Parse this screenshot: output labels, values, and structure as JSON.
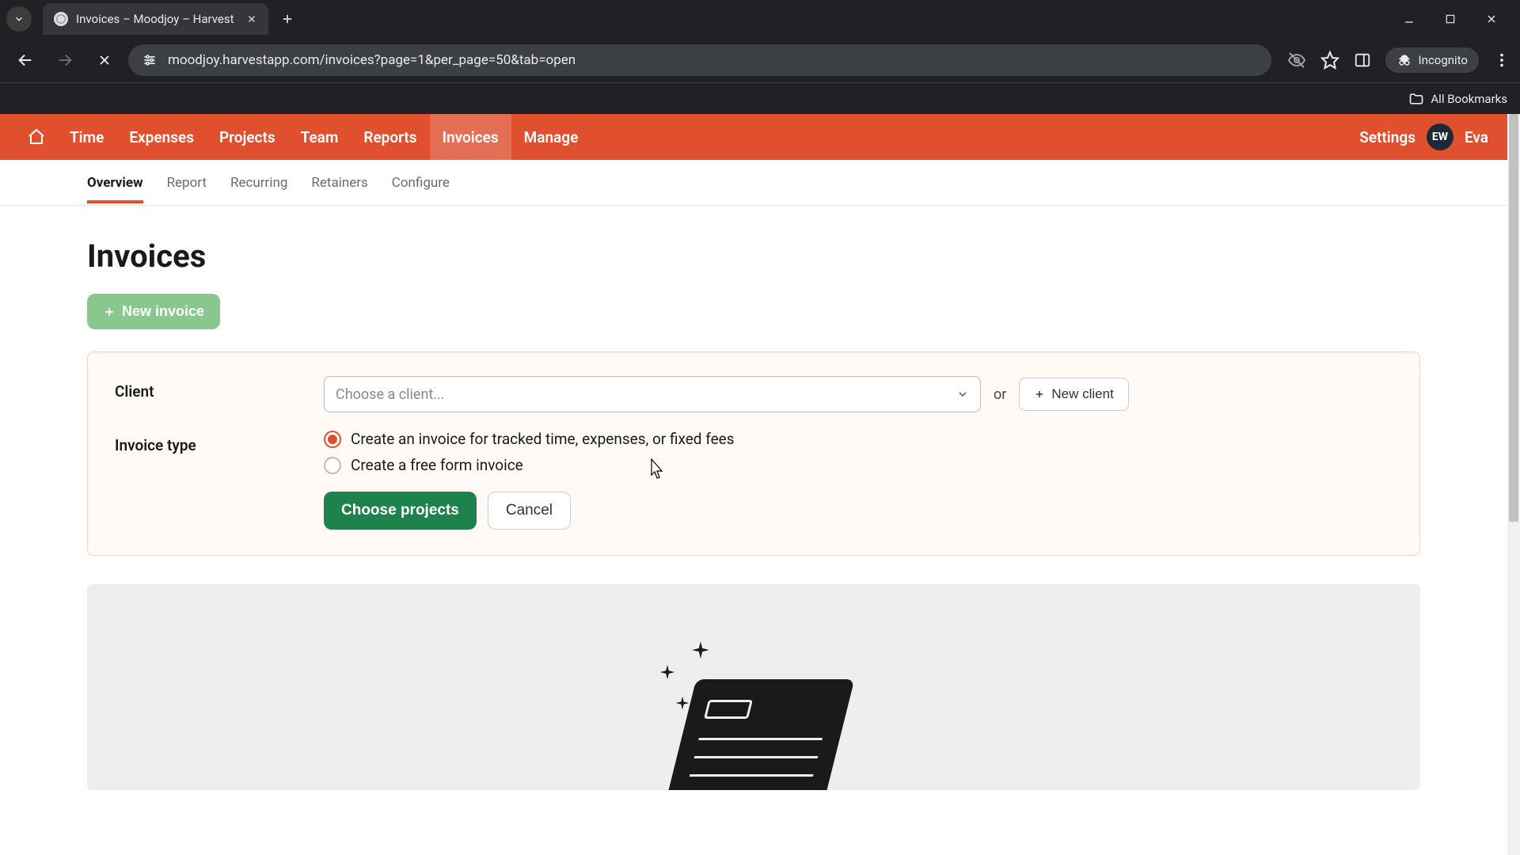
{
  "browser": {
    "tab_title": "Invoices – Moodjoy – Harvest",
    "url": "moodjoy.harvestapp.com/invoices?page=1&per_page=50&tab=open",
    "incognito_label": "Incognito",
    "all_bookmarks_label": "All Bookmarks"
  },
  "topnav": {
    "items": [
      "Time",
      "Expenses",
      "Projects",
      "Team",
      "Reports",
      "Invoices",
      "Manage"
    ],
    "active": "Invoices",
    "settings_label": "Settings",
    "user_initials": "EW",
    "user_name": "Eva"
  },
  "subtabs": {
    "items": [
      "Overview",
      "Report",
      "Recurring",
      "Retainers",
      "Configure"
    ],
    "active": "Overview"
  },
  "page": {
    "title": "Invoices",
    "new_invoice_label": "New invoice"
  },
  "form": {
    "client_label": "Client",
    "client_placeholder": "Choose a client...",
    "or_label": "or",
    "new_client_label": "New client",
    "invoice_type_label": "Invoice type",
    "radio_tracked": "Create an invoice for tracked time, expenses, or fixed fees",
    "radio_freeform": "Create a free form invoice",
    "choose_projects_label": "Choose projects",
    "cancel_label": "Cancel"
  },
  "colors": {
    "brand_red": "#e0502f",
    "action_green": "#1e824c",
    "soft_green": "#89c78f"
  }
}
